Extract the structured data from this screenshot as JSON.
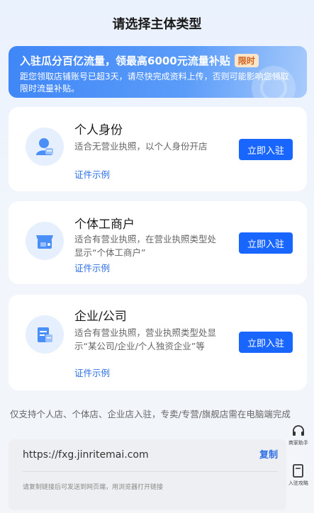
{
  "page": {
    "title": "请选择主体类型"
  },
  "banner": {
    "line1": "入驻瓜分百亿流量，领最高6000元流量补贴",
    "badge": "限时",
    "line2": "距您领取店铺账号已超3天，请尽快完成资料上传，否则可能影响您领取限时流量补贴。"
  },
  "cards": [
    {
      "name": "个人身份",
      "desc": "适合无营业执照，以个人身份开店",
      "example": "证件示例",
      "button": "立即入驻",
      "icon": "person-icon"
    },
    {
      "name": "个体工商户",
      "desc": "适合有营业执照，在营业执照类型处显示“个体工商户”",
      "example": "证件示例",
      "button": "立即入驻",
      "icon": "shop-icon"
    },
    {
      "name": "企业/公司",
      "desc": "适合有营业执照，营业执照类型处显示“某公司/企业/个人独资企业”等",
      "example": "证件示例",
      "button": "立即入驻",
      "icon": "company-icon"
    }
  ],
  "note": "仅支持个人店、个体店、企业店入驻，专卖/专营/旗舰店需在电脑端完成",
  "link": {
    "url": "https://fxg.jinritemai.com",
    "copy": "复制",
    "tip": "请复制链接后可发送到网页端，用浏览器打开链接"
  },
  "side": {
    "helper": "商家助手",
    "guide": "入驻攻略"
  },
  "colors": {
    "primary": "#1966ff",
    "link": "#2e6fe6",
    "banner": "#4a8ef8"
  }
}
